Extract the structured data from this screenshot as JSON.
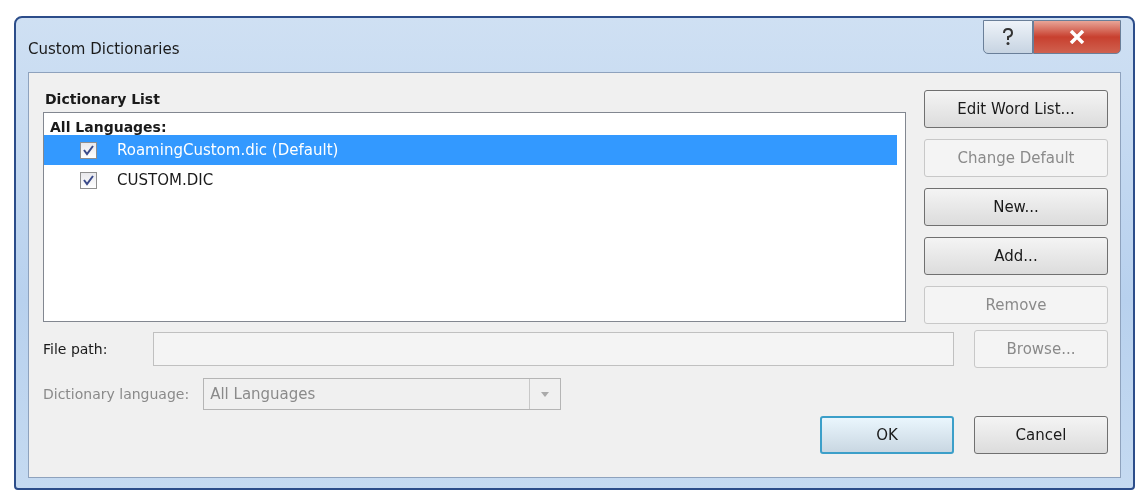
{
  "window": {
    "title": "Custom Dictionaries"
  },
  "dictionary_list": {
    "label": "Dictionary List",
    "group": "All Languages:",
    "items": [
      {
        "name": "RoamingCustom.dic (Default)",
        "checked": true,
        "selected": true
      },
      {
        "name": "CUSTOM.DIC",
        "checked": true,
        "selected": false
      }
    ]
  },
  "side_buttons": [
    {
      "label": "Edit Word List...",
      "disabled": false
    },
    {
      "label": "Change Default",
      "disabled": true
    },
    {
      "label": "New...",
      "disabled": false
    },
    {
      "label": "Add...",
      "disabled": false
    },
    {
      "label": "Remove",
      "disabled": true
    }
  ],
  "file_path": {
    "label": "File path:",
    "disabled": true
  },
  "browse_button": {
    "label": "Browse...",
    "disabled": true
  },
  "dictionary_language": {
    "label": "Dictionary language:",
    "value": "All Languages",
    "disabled": true
  },
  "footer_buttons": [
    {
      "label": "OK",
      "default": true
    },
    {
      "label": "Cancel",
      "default": false
    }
  ]
}
